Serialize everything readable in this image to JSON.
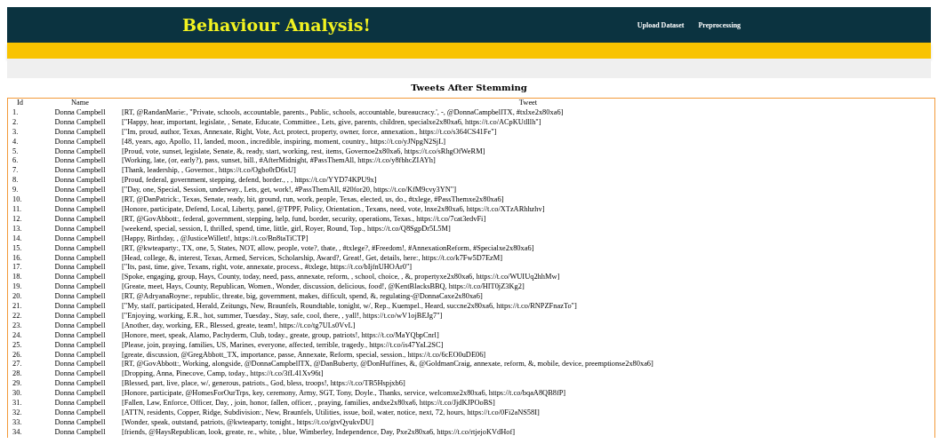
{
  "header": {
    "title": "Behaviour Analysis!",
    "nav": [
      "Upload Dataset",
      "Preprocessing"
    ]
  },
  "section_title": "Tweets After Stemming",
  "table": {
    "columns": [
      "Id",
      "Name",
      "Tweet"
    ],
    "rows": [
      [
        "1.",
        "Donna Campbell",
        "[RT, @RandanMarie:, \"Private, schools, accountable, parents., Public, schools, accountable, bureaucracy.', -, @DonnaCampbellTX, #txlxe2x80xa6]"
      ],
      [
        "2.",
        "Donna Campbell",
        "[\"Happy, hear, important, legislate, , Senate, Educate, Committee., Lets, give, parents, children, specialxe2x80xa6, https://t.co/ACpKUtlllh\"]"
      ],
      [
        "3.",
        "Donna Campbell",
        "[\"Im, proud, author, Texas, Annexate, Right, Vote, Act, protect, property, owner, force, annexation., https://t.co/s364CS41Fe\"]"
      ],
      [
        "4.",
        "Donna Campbell",
        "[48, years, ago, Apollo, 11, landed, moon., incredible, inspiring, moment, country., https://t.co/yJNpgN2SjL]"
      ],
      [
        "5.",
        "Donna Campbell",
        "[Proud, vote, sunset, legislate, Senate, &, ready, start, working, rest, items, Governoe2x80xa6, https://t.co/sRhgOfWeRM]"
      ],
      [
        "6.",
        "Donna Campbell",
        "[Working, late, (or, early?), pass, sunset, bill., #AfterMidnight, #PassThemAll, https://t.co/y8fbhcZIAYh]"
      ],
      [
        "7.",
        "Donna Campbell",
        "[Thank, leadership, , Governor., https://t.co/Ogbo0rD6xU]"
      ],
      [
        "8.",
        "Donna Campbell",
        "[Proud, federal, government, stepping, defend, border., , , https://t.co/YYD74KPU9x]"
      ],
      [
        "9.",
        "Donna Campbell",
        "[\"Day, one, Special, Session, underway., Lets, get, work!, #PassThemAll, #20for20, https://t.co/KfM9cvy3YN\"]"
      ],
      [
        "10.",
        "Donna Campbell",
        "[RT, @DanPatrick:, Texas, Senate, ready, hit, ground, run, work, people, Texas, elected, us, do., #txlege, #PassThemxe2x80xa6]"
      ],
      [
        "11.",
        "Donna Campbell",
        "[Honore, participate, Defend, Local, Liberty, panel, @TPPF, Policy, Orientation., Texans, need, vote, lnxe2x80xa6, https://t.co/XTzARhhzhv]"
      ],
      [
        "12.",
        "Donna Campbell",
        "[RT, @GovAbbott:, federal, government, stepping, help, fund, border, security, operations, Texas., https://t.co/7cat3edvFi]"
      ],
      [
        "13.",
        "Donna Campbell",
        "[weekend, special, session, I, thrilled, spend, time, little, girl, Royer, Round, Top., https://t.co/Q8SgpDr5L5M]"
      ],
      [
        "14.",
        "Donna Campbell",
        "[Happy, Birthday, , @JusticeWillett!, https://t.co/Bn8taTiCTP]"
      ],
      [
        "15.",
        "Donna Campbell",
        "[RT, @kwteaparty:, TX, one, 5, States, NOT, allow, people, vote?, thate, , #txlege?, #Freedom!, #AnnexationReform, #Specialxe2x80xa6]"
      ],
      [
        "16.",
        "Donna Campbell",
        "[Head, college, &, interest, Texas, Armed, Services, Scholarship, Award?, Great!, Get, details, here:, https://t.co/k7Fw5D7EzM]"
      ],
      [
        "17.",
        "Donna Campbell",
        "[\"Its, past, time, give, Texans, right, vote, annexate, process., #txlege, https://t.co/bIjfnUHOAr0\"]"
      ],
      [
        "18.",
        "Donna Campbell",
        "[Spoke, engaging, group, Hays, County, today, need, pass, annexate, reform, , school, choice, , &, propertyxe2x80xa6, https://t.co/WUIUq2hhMw]"
      ],
      [
        "19.",
        "Donna Campbell",
        "[Greate, meet, Hays, County, Republican, Women., Wonder, discussion, delicious, food!, @KentBlacksBBQ, https://t.co/HIT0jZ3Kg2]"
      ],
      [
        "20.",
        "Donna Campbell",
        "[RT, @AdryanaBoyne:, republic, threate, big, government, makes, difficult, spend, &, regulating-@DonnaCaxe2x80xa6]"
      ],
      [
        "21.",
        "Donna Campbell",
        "[\"My, staff, participated, Herald, Zeitungs, New, Braunfels, Roundtable, tonight, w/, Rep., Kuempel., Heard, succne2x80xa6, https://t.co/RNPZFnazTo\"]"
      ],
      [
        "22.",
        "Donna Campbell",
        "[\"Enjoying, working, E.R., hot, summer, Tuesday., Stay, safe, cool, there, , yall!, https://t.co/wV1ojBEJg7\"]"
      ],
      [
        "23.",
        "Donna Campbell",
        "[Another, day, working, ER., Blessed, greate, team!, https://t.co/tg7ULs0VvL]"
      ],
      [
        "24.",
        "Donna Campbell",
        "[Honore, meet, speak, Alamo, Pachyderm, Club, today., greate, group, patriots!, https://t.co/MaYQbpCnrl]"
      ],
      [
        "25.",
        "Donna Campbell",
        "[Please, join, praying, families, US, Marines, everyone, affected, terrible, tragedy., https://t.co/is47YaL2SC]"
      ],
      [
        "26.",
        "Donna Campbell",
        "[greate, discussion, @GregAbbott_TX, importance, passe, Annexate, Reform, special, session., https://t.co/6cEO0uDE06]"
      ],
      [
        "27.",
        "Donna Campbell",
        "[RT, @GovAbbott:, Working, alongside, @DonnaCampbellTX, @DanBuberty, @DonHuffines, &, @GoldmanCraig, annexate, reform, &, mobile, device, preemptionse2x80xa6]"
      ],
      [
        "28.",
        "Donna Campbell",
        "[Dropping, Anna, Pinecove, Camp, today., https://t.co/3fL41Xv96t]"
      ],
      [
        "29.",
        "Donna Campbell",
        "[Blessed, part, live, place, w/, generous, patriots., God, bless, troops!, https://t.co/TB5Hspjxb6]"
      ],
      [
        "30.",
        "Donna Campbell",
        "[Honore, participate, @HomesForOurTrps, key, ceremony, Army, SGT, Tony, Doyle., Thanks, service, welcomxe2x80xa6, https://t.co/bqaA8QB8fP]"
      ],
      [
        "31.",
        "Donna Campbell",
        "[Fallen, Law, Enforce, Officer, Day, , join, honor, fallen, officer, , praying, families, andxe2x80xa6, https://t.co/JjdKJPOoBS]"
      ],
      [
        "32.",
        "Donna Campbell",
        "[ATTN, residents, Copper, Ridge, Subdivision:, New, Braunfels, Utilities, issue, boil, water, notice, next, 72, hours, https://t.co/0Fi2aNS58I]"
      ],
      [
        "33.",
        "Donna Campbell",
        "[Wonder, speak, outstand, patriots, @kwteaparty, tonight., https://t.co/gtvQyukvDU]"
      ],
      [
        "34.",
        "Donna Campbell",
        "[friends, @HaysRepublican, look, greate, re., white, , blue, Wimberley, Independence, Day, Pxe2x80xa6, https://t.co/rtjejoKVdHof]"
      ]
    ]
  }
}
